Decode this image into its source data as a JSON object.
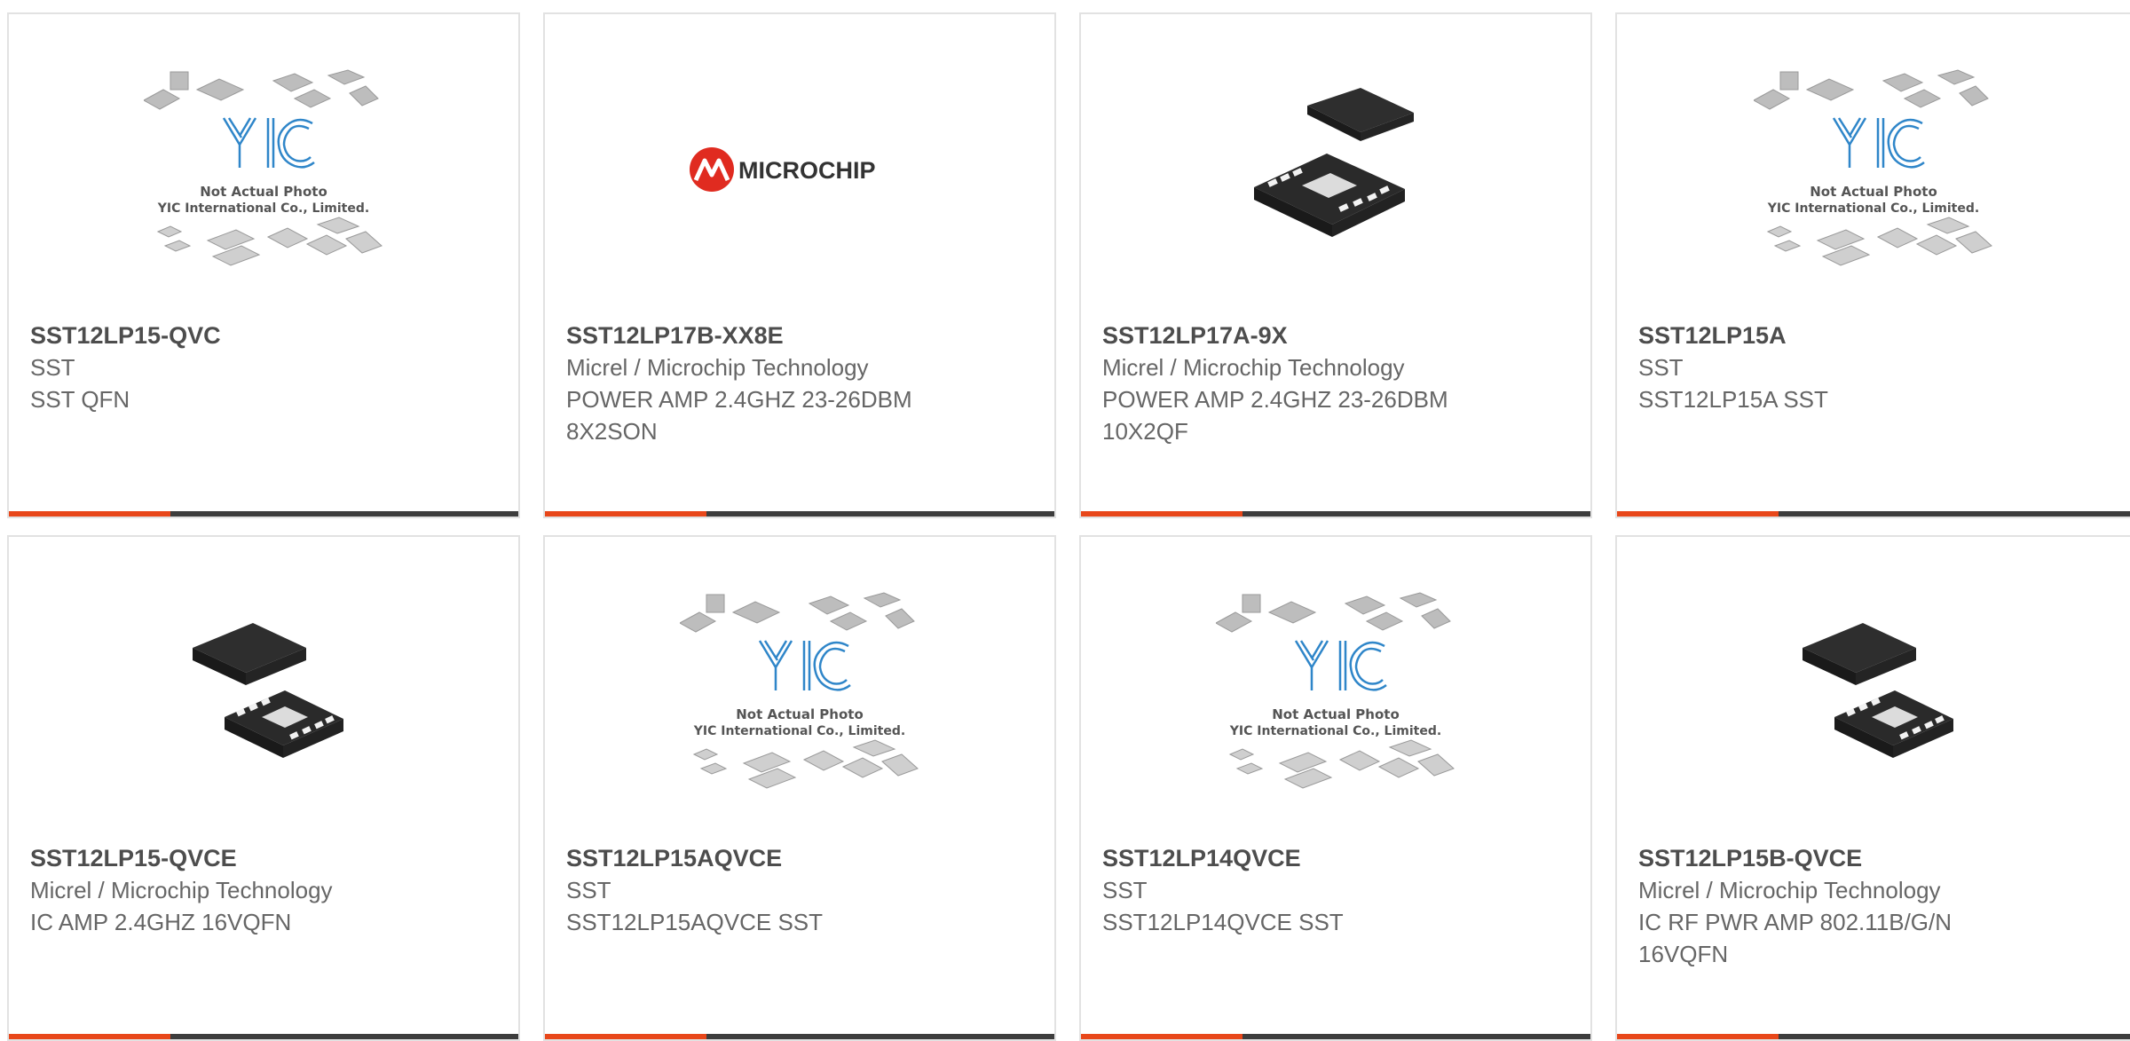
{
  "products": [
    {
      "part_number": "SST12LP15-QVC",
      "manufacturer": "SST",
      "description": "SST QFN",
      "image": "not-actual-photo-placeholder",
      "image_caption_line1": "Not Actual Photo",
      "image_caption_line2": "YIC International Co., Limited."
    },
    {
      "part_number": "SST12LP17B-XX8E",
      "manufacturer": "Micrel / Microchip Technology",
      "description": "POWER AMP 2.4GHZ 23-26DBM 8X2SON",
      "image": "microchip-logo",
      "logo_text": "MICROCHIP"
    },
    {
      "part_number": "SST12LP17A-9X",
      "manufacturer": "Micrel / Microchip Technology",
      "description": "POWER AMP 2.4GHZ 23-26DBM 10X2QF",
      "image": "qfn-chip-photo"
    },
    {
      "part_number": "SST12LP15A",
      "manufacturer": "SST",
      "description": "SST12LP15A SST",
      "image": "not-actual-photo-placeholder",
      "image_caption_line1": "Not Actual Photo",
      "image_caption_line2": "YIC International Co., Limited."
    },
    {
      "part_number": "SST12LP15-QVCE",
      "manufacturer": "Micrel / Microchip Technology",
      "description": "IC AMP 2.4GHZ 16VQFN",
      "image": "qfn-chip-photo"
    },
    {
      "part_number": "SST12LP15AQVCE",
      "manufacturer": "SST",
      "description": "SST12LP15AQVCE SST",
      "image": "not-actual-photo-placeholder",
      "image_caption_line1": "Not Actual Photo",
      "image_caption_line2": "YIC International Co., Limited."
    },
    {
      "part_number": "SST12LP14QVCE",
      "manufacturer": "SST",
      "description": "SST12LP14QVCE SST",
      "image": "not-actual-photo-placeholder",
      "image_caption_line1": "Not Actual Photo",
      "image_caption_line2": "YIC International Co., Limited."
    },
    {
      "part_number": "SST12LP15B-QVCE",
      "manufacturer": "Micrel / Microchip Technology",
      "description": "IC RF PWR AMP 802.11B/G/N 16VQFN",
      "image": "qfn-chip-photo"
    }
  ],
  "colors": {
    "accent": "#e8471a",
    "bar_dark": "#3d3d3d",
    "yic_logo_blue": "#2f86c9",
    "microchip_red": "#e02b20",
    "chip_black": "#2a2a2a",
    "card_border": "#e2e2e2"
  }
}
